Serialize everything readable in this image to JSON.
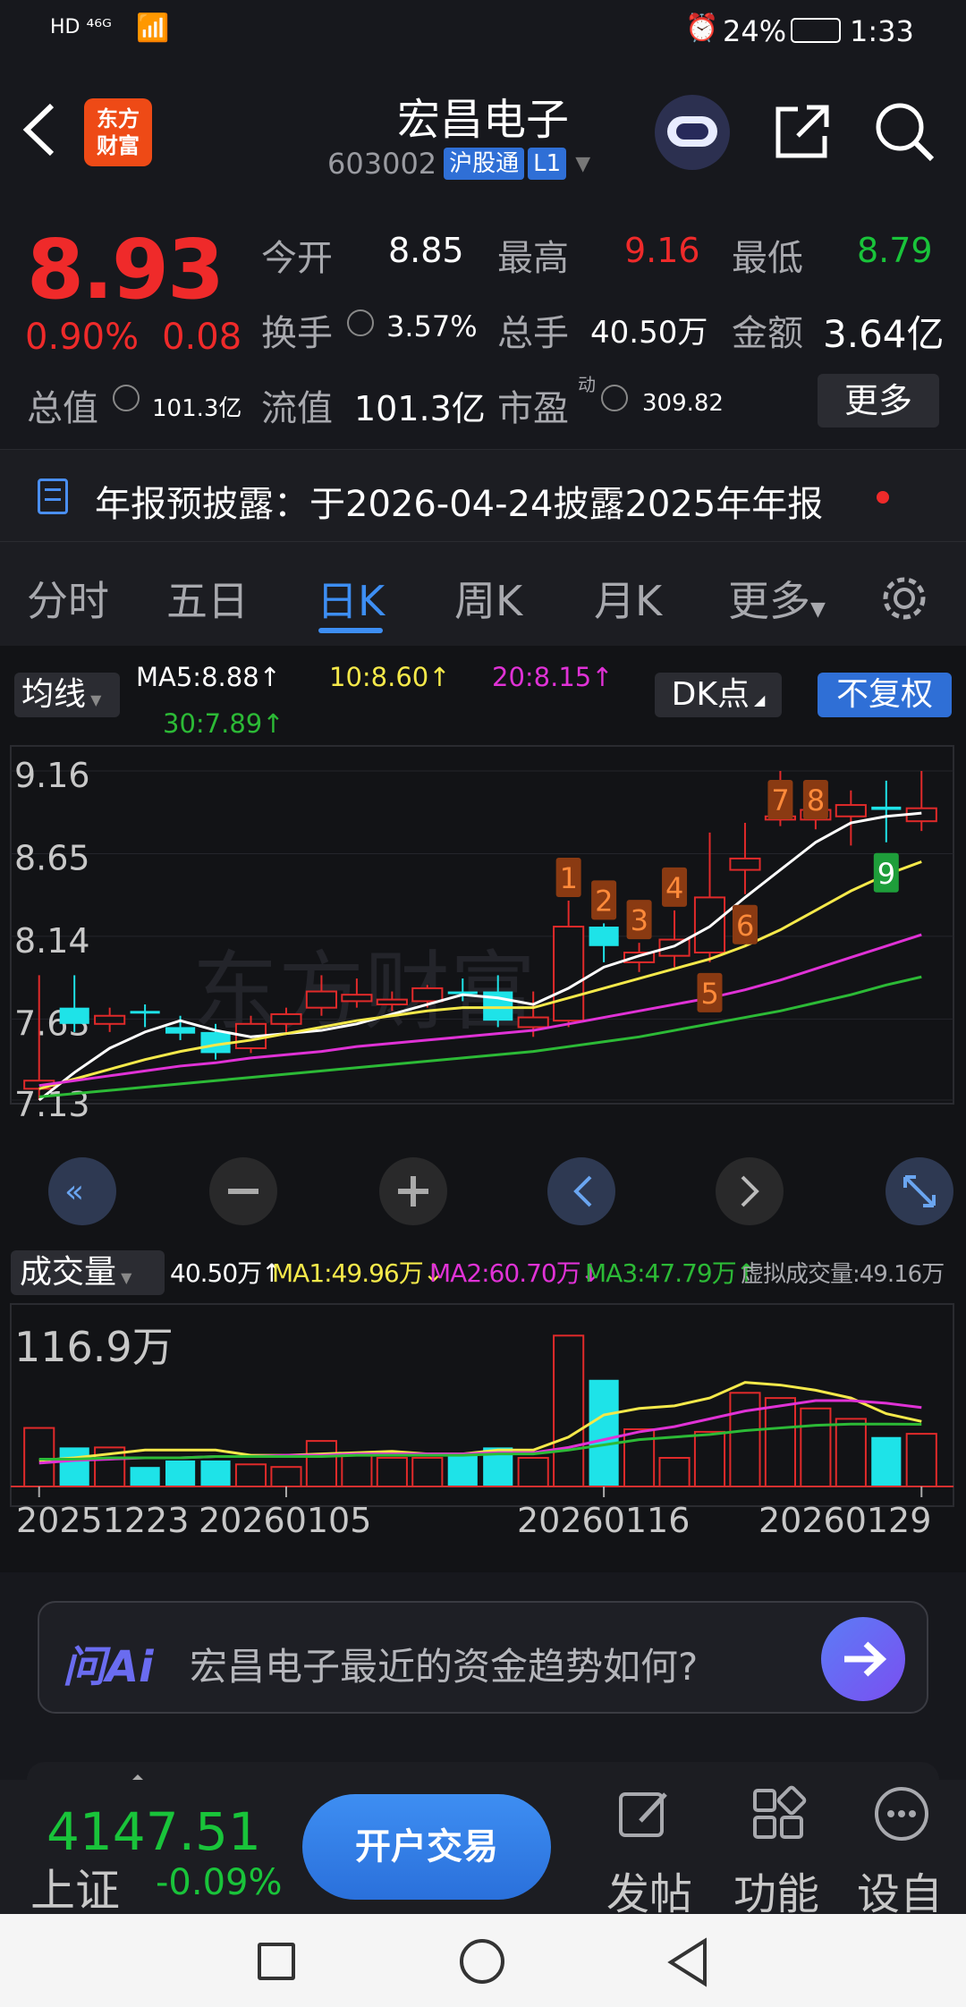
{
  "status_bar": {
    "left": "HD ⁴⁶ᴳ",
    "battery": "24%",
    "time": "1:33"
  },
  "header": {
    "title": "宏昌电子",
    "code": "603002",
    "tag": "沪股通",
    "level": "L1",
    "logo_line1": "东方",
    "logo_line2": "财富"
  },
  "quote": {
    "price": "8.93",
    "change_pct": "0.90%",
    "change": "0.08",
    "open_label": "今开",
    "open": "8.85",
    "high_label": "最高",
    "high": "9.16",
    "low_label": "最低",
    "low": "8.79",
    "turnover_label": "换手",
    "turnover": "3.57%",
    "volume_label": "总手",
    "volume": "40.50万",
    "amount_label": "金额",
    "amount": "3.64亿",
    "mktcap_label": "总值",
    "mktcap": "101.3亿",
    "float_label": "流值",
    "float": "101.3亿",
    "pe_label": "市盈",
    "pe_sup": "动",
    "pe": "309.82",
    "more_label": "更多"
  },
  "notice": {
    "text": "年报预披露：于2026-04-24披露2025年年报"
  },
  "tabs": [
    "分时",
    "五日",
    "日K",
    "周K",
    "月K",
    "更多"
  ],
  "active_tab": "日K",
  "ma_bar": {
    "selector": "均线",
    "ma5": "MA5:8.88↑",
    "ma10": "10:8.60↑",
    "ma20": "20:8.15↑",
    "ma30": "30:7.89↑",
    "dk": "DK点",
    "fq": "不复权"
  },
  "vol_bar": {
    "selector": "成交量",
    "vol": "40.50万↑",
    "ma1": "MA1:49.96万↓",
    "ma2": "MA2:60.70万↓",
    "ma3": "MA3:47.79万↑",
    "virtual": "虚拟成交量:49.16万"
  },
  "chart_data": {
    "type": "candlestick",
    "y_ticks": [
      "9.16",
      "8.65",
      "8.14",
      "7.63",
      "7.13"
    ],
    "ylim": [
      7.13,
      9.16
    ],
    "candles": [
      {
        "o": 7.2,
        "h": 7.9,
        "l": 7.13,
        "c": 7.25,
        "up": true
      },
      {
        "o": 7.7,
        "h": 7.9,
        "l": 7.55,
        "c": 7.6,
        "up": false
      },
      {
        "o": 7.6,
        "h": 7.7,
        "l": 7.55,
        "c": 7.65,
        "up": true
      },
      {
        "o": 7.68,
        "h": 7.72,
        "l": 7.58,
        "c": 7.68,
        "up": false
      },
      {
        "o": 7.58,
        "h": 7.65,
        "l": 7.5,
        "c": 7.54,
        "up": false
      },
      {
        "o": 7.55,
        "h": 7.6,
        "l": 7.38,
        "c": 7.42,
        "up": false
      },
      {
        "o": 7.45,
        "h": 7.65,
        "l": 7.42,
        "c": 7.6,
        "up": true
      },
      {
        "o": 7.6,
        "h": 7.7,
        "l": 7.55,
        "c": 7.66,
        "up": true
      },
      {
        "o": 7.7,
        "h": 7.9,
        "l": 7.65,
        "c": 7.8,
        "up": true
      },
      {
        "o": 7.74,
        "h": 7.88,
        "l": 7.7,
        "c": 7.78,
        "up": true
      },
      {
        "o": 7.72,
        "h": 7.8,
        "l": 7.68,
        "c": 7.75,
        "up": true
      },
      {
        "o": 7.74,
        "h": 7.84,
        "l": 7.7,
        "c": 7.82,
        "up": true
      },
      {
        "o": 7.8,
        "h": 7.88,
        "l": 7.74,
        "c": 7.8,
        "up": false
      },
      {
        "o": 7.8,
        "h": 7.9,
        "l": 7.58,
        "c": 7.62,
        "up": false
      },
      {
        "o": 7.58,
        "h": 7.8,
        "l": 7.52,
        "c": 7.64,
        "up": true
      },
      {
        "o": 7.62,
        "h": 8.36,
        "l": 7.58,
        "c": 8.2,
        "up": true
      },
      {
        "o": 8.2,
        "h": 8.22,
        "l": 7.98,
        "c": 8.08,
        "up": false
      },
      {
        "o": 7.98,
        "h": 8.1,
        "l": 7.92,
        "c": 8.04,
        "up": true
      },
      {
        "o": 8.02,
        "h": 8.3,
        "l": 7.95,
        "c": 8.12,
        "up": true
      },
      {
        "o": 8.04,
        "h": 8.78,
        "l": 7.98,
        "c": 8.38,
        "up": true
      },
      {
        "o": 8.55,
        "h": 8.84,
        "l": 8.4,
        "c": 8.62,
        "up": true
      },
      {
        "o": 8.86,
        "h": 9.16,
        "l": 8.82,
        "c": 8.88,
        "up": true
      },
      {
        "o": 8.86,
        "h": 9.1,
        "l": 8.8,
        "c": 8.92,
        "up": true
      },
      {
        "o": 8.88,
        "h": 9.04,
        "l": 8.7,
        "c": 8.95,
        "up": true
      },
      {
        "o": 8.94,
        "h": 9.1,
        "l": 8.72,
        "c": 8.92,
        "up": false
      },
      {
        "o": 8.85,
        "h": 9.16,
        "l": 8.79,
        "c": 8.93,
        "up": true
      }
    ],
    "labels": [
      {
        "text": "1",
        "i": 15
      },
      {
        "text": "2",
        "i": 16
      },
      {
        "text": "3",
        "i": 17
      },
      {
        "text": "4",
        "i": 18
      },
      {
        "text": "5",
        "i": 19
      },
      {
        "text": "6",
        "i": 20
      },
      {
        "text": "7",
        "i": 21
      },
      {
        "text": "8",
        "i": 22
      },
      {
        "text": "9",
        "i": 24
      }
    ],
    "ma5": [
      7.13,
      7.3,
      7.45,
      7.55,
      7.62,
      7.56,
      7.52,
      7.54,
      7.56,
      7.6,
      7.66,
      7.72,
      7.78,
      7.76,
      7.72,
      7.82,
      7.95,
      8.02,
      8.08,
      8.2,
      8.38,
      8.55,
      8.72,
      8.84,
      8.88,
      8.9
    ],
    "ma10": [
      7.2,
      7.26,
      7.32,
      7.38,
      7.43,
      7.47,
      7.5,
      7.54,
      7.58,
      7.62,
      7.65,
      7.68,
      7.7,
      7.7,
      7.7,
      7.76,
      7.82,
      7.88,
      7.94,
      8.0,
      8.08,
      8.18,
      8.3,
      8.42,
      8.52,
      8.6
    ],
    "ma20": [
      7.22,
      7.25,
      7.28,
      7.31,
      7.34,
      7.36,
      7.39,
      7.41,
      7.43,
      7.46,
      7.48,
      7.5,
      7.52,
      7.54,
      7.56,
      7.6,
      7.64,
      7.68,
      7.72,
      7.76,
      7.81,
      7.87,
      7.94,
      8.01,
      8.08,
      8.15
    ],
    "ma30": [
      7.15,
      7.17,
      7.19,
      7.21,
      7.23,
      7.25,
      7.27,
      7.29,
      7.31,
      7.33,
      7.35,
      7.37,
      7.39,
      7.41,
      7.43,
      7.46,
      7.49,
      7.52,
      7.56,
      7.6,
      7.64,
      7.68,
      7.73,
      7.78,
      7.84,
      7.89
    ],
    "volume_max_label": "116.9万",
    "volume": [
      45,
      30,
      30,
      15,
      20,
      20,
      17,
      15,
      35,
      24,
      22,
      22,
      25,
      30,
      22,
      116,
      82,
      44,
      22,
      42,
      72,
      68,
      60,
      52,
      38,
      40.5
    ],
    "vol_ma1": [
      20,
      22,
      25,
      28,
      28,
      28,
      24,
      24,
      25,
      26,
      27,
      25,
      25,
      28,
      28,
      38,
      55,
      60,
      62,
      68,
      80,
      78,
      74,
      68,
      56,
      50
    ],
    "vol_ma2": [
      18,
      20,
      21,
      22,
      22,
      23,
      23,
      24,
      24,
      25,
      25,
      25,
      25,
      26,
      26,
      30,
      36,
      42,
      46,
      52,
      58,
      62,
      66,
      66,
      64,
      60.7
    ],
    "vol_ma3": [
      21,
      21,
      22,
      22,
      22,
      23,
      23,
      23,
      23,
      24,
      24,
      24,
      24,
      25,
      25,
      28,
      32,
      36,
      38,
      40,
      43,
      45,
      47,
      48,
      48,
      47.8
    ],
    "dates": [
      "20251223",
      "20260105",
      "20260116",
      "20260129"
    ]
  },
  "ai_bar": {
    "brand": "问Ai",
    "question": "宏昌电子最近的资金趋势如何?"
  },
  "bottom": {
    "index_value": "4147.51",
    "index_name": "上证",
    "index_change": "-0.09%",
    "trade_button": "开户交易",
    "post": "发帖",
    "func": "功能",
    "settings": "设自"
  }
}
